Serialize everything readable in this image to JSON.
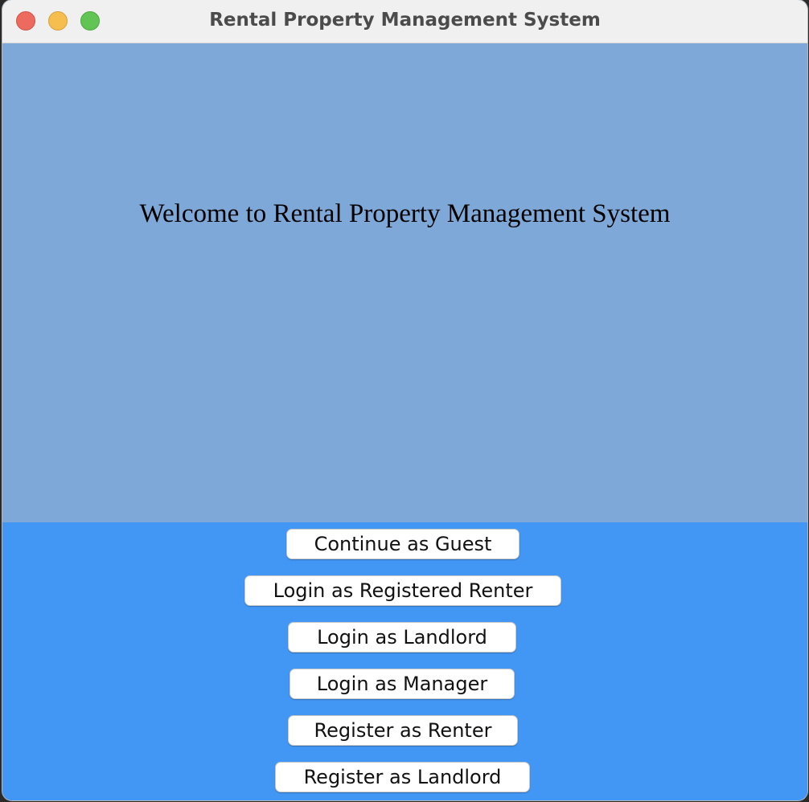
{
  "window": {
    "title": "Rental Property Management System"
  },
  "welcome": {
    "text": "Welcome to Rental Property Management System"
  },
  "buttons": {
    "guest": "Continue as Guest",
    "login_renter": "Login as Registered Renter",
    "login_landlord": "Login as Landlord",
    "login_manager": "Login as Manager",
    "register_renter": "Register as Renter",
    "register_landlord": "Register as Landlord"
  },
  "colors": {
    "welcome_panel": "#7ea8d8",
    "button_panel": "#4296f4",
    "titlebar": "#f1f0f0"
  }
}
